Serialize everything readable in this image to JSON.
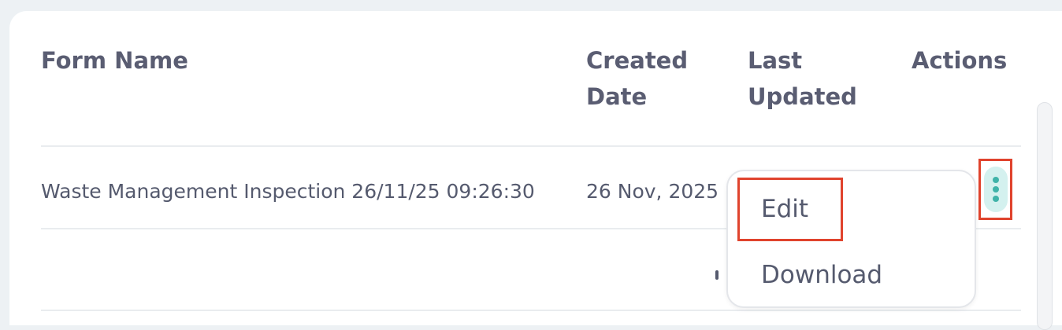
{
  "table": {
    "headers": {
      "form_name": "Form Name",
      "created_date_line1": "Created",
      "created_date_line2": "Date",
      "last_updated_line1": "Last",
      "last_updated_line2": "Updated",
      "actions": "Actions"
    },
    "rows": [
      {
        "form_name": "Waste Management Inspection 26/11/25 09:26:30",
        "created_date": "26 Nov, 2025"
      }
    ]
  },
  "actions_menu": {
    "items": [
      "Edit",
      "Download"
    ],
    "highlighted": "Edit"
  },
  "icons": {
    "kebab": "more-vertical-icon"
  },
  "colors": {
    "header_text": "#5a5d72",
    "body_text": "#555a6e",
    "highlight": "#e0432d",
    "kebab_bg": "#d4f1ef",
    "kebab_dots": "#3fb3a9",
    "page_bg": "#edf1f4"
  }
}
